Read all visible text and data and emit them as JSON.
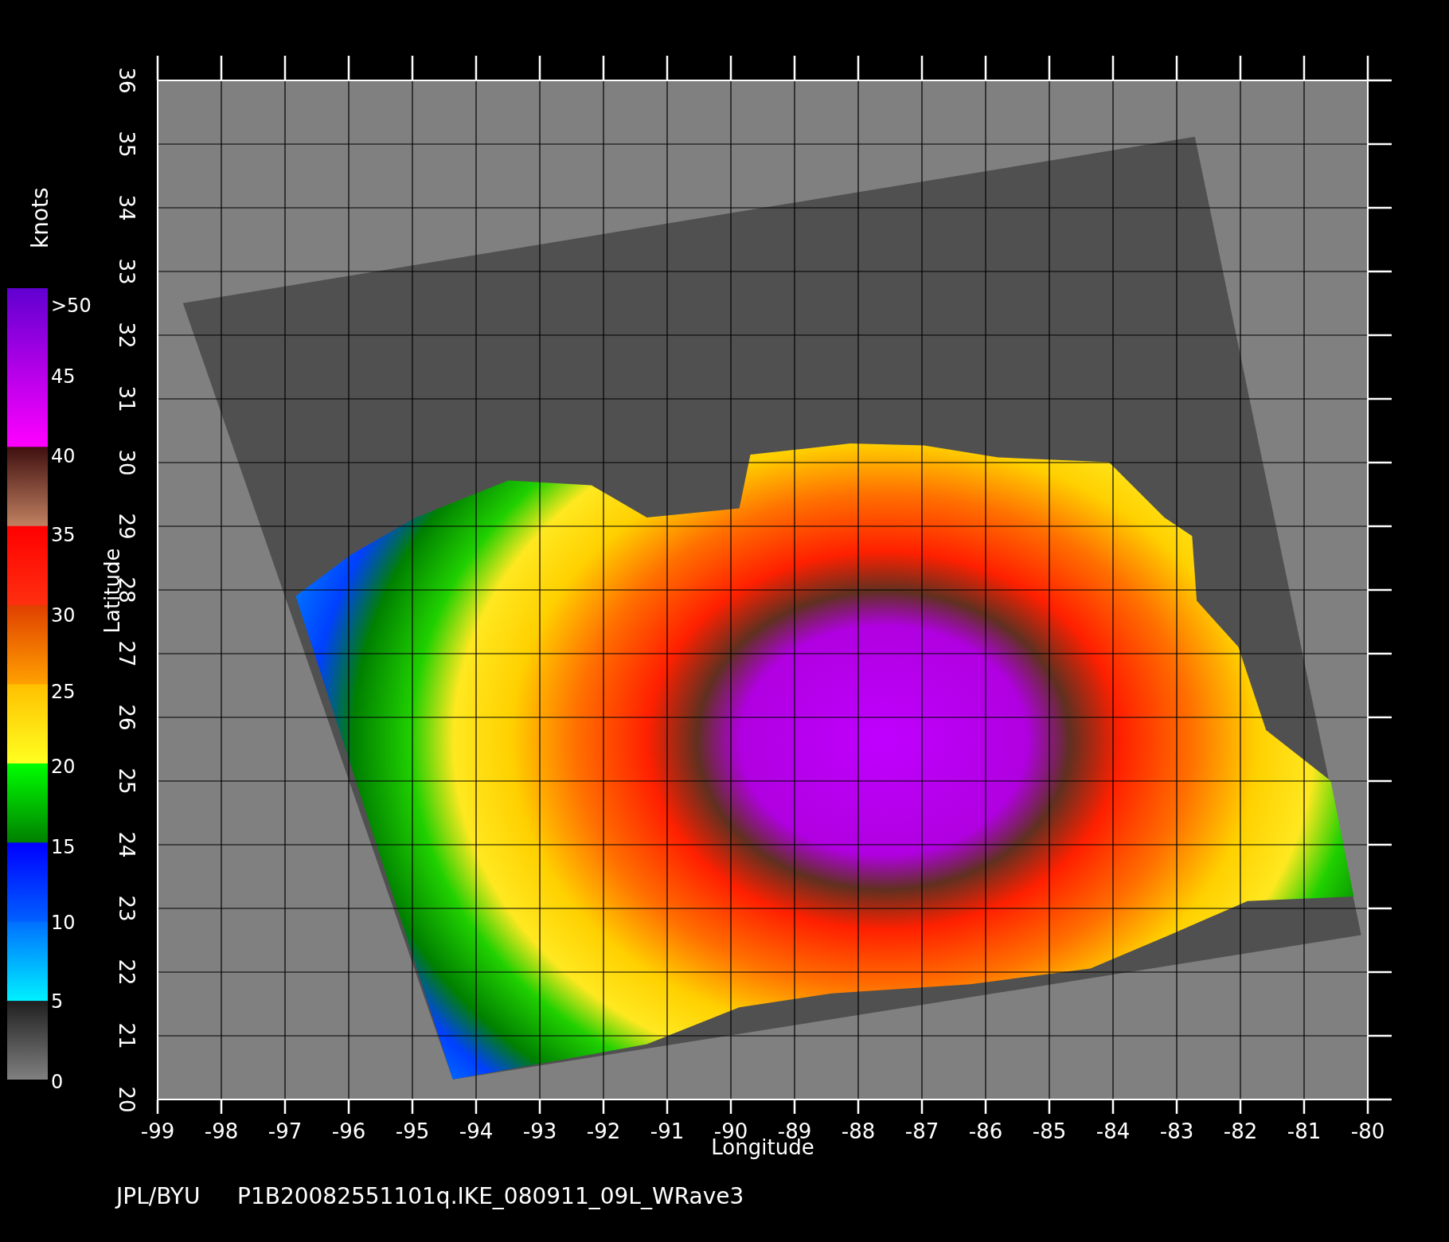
{
  "colorbar": {
    "unit": "knots",
    "labels": [
      ">50",
      "45",
      "40",
      "35",
      "30",
      "25",
      "20",
      "15",
      "10",
      "5",
      "0"
    ]
  },
  "y_axis": {
    "label": "Latitude",
    "ticks": [
      "20",
      "21",
      "22",
      "23",
      "24",
      "25",
      "26",
      "27",
      "28",
      "29",
      "30",
      "31",
      "32",
      "33",
      "34",
      "35",
      "36"
    ]
  },
  "x_axis": {
    "label": "Longitude",
    "ticks": [
      "-99",
      "-98",
      "-97",
      "-96",
      "-95",
      "-94",
      "-93",
      "-92",
      "-91",
      "-90",
      "-89",
      "-88",
      "-87",
      "-86",
      "-85",
      "-84",
      "-83",
      "-82",
      "-81",
      "-80"
    ]
  },
  "footer": {
    "source": "JPL/BYU",
    "file": "P1B20082551101q.IKE_080911_09L_WRave3"
  }
}
